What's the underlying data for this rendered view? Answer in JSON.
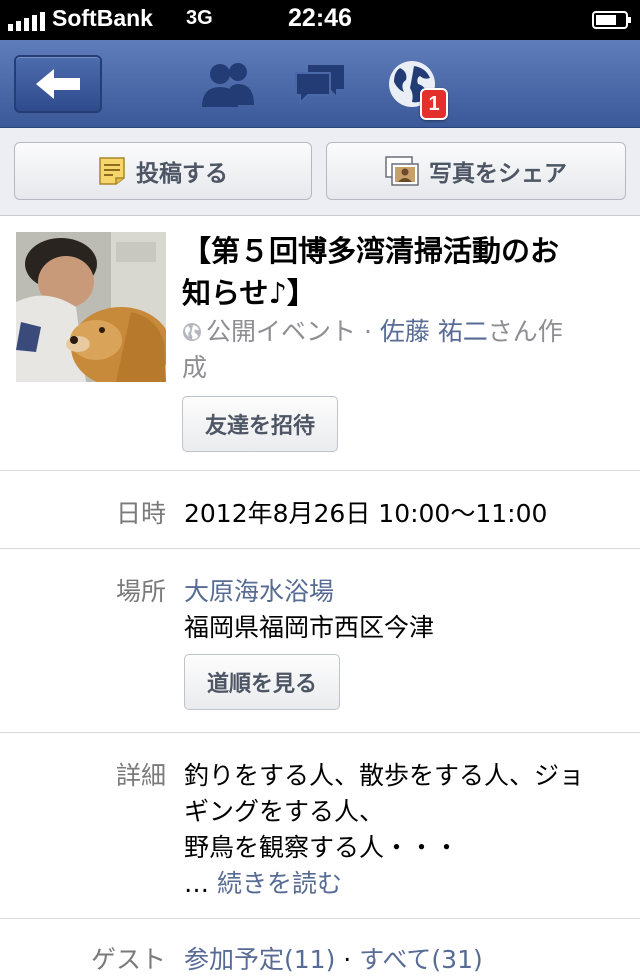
{
  "status_bar": {
    "carrier": "SoftBank",
    "network": "3G",
    "time": "22:46"
  },
  "nav": {
    "back_icon": "back-arrow-icon",
    "friends_icon": "friends-icon",
    "messages_icon": "messages-icon",
    "notifications_icon": "globe-icon",
    "notification_count": "1"
  },
  "actions": {
    "post_label": "投稿する",
    "photo_label": "写真をシェア"
  },
  "event": {
    "title_line1": "【第５回博多湾清掃活動のお",
    "title_line2": "知らせ♪】",
    "visibility": "公開イベント · ",
    "host": "佐藤 祐二",
    "host_suffix_line1": "さん作",
    "host_suffix_line2": "成",
    "invite_label": "友達を招待"
  },
  "details": {
    "date_label": "日時",
    "date_value": "2012年8月26日 10:00〜11:00",
    "place_label": "場所",
    "place_name": "大原海水浴場",
    "place_address": "福岡県福岡市西区今津",
    "directions_label": "道順を見る",
    "detail_label": "詳細",
    "detail_line1": "釣りをする人、散歩をする人、ジョ",
    "detail_line2": "ギングをする人、",
    "detail_line3": "野鳥を観察する人・・・",
    "detail_ellipsis": "… ",
    "read_more": "続きを読む",
    "guest_label": "ゲスト",
    "guest_going": "参加予定(11)",
    "guest_sep": " · ",
    "guest_all": "すべて(31)"
  },
  "colors": {
    "nav_blue": "#3b5998",
    "link": "#576b95",
    "badge": "#e4302d"
  }
}
